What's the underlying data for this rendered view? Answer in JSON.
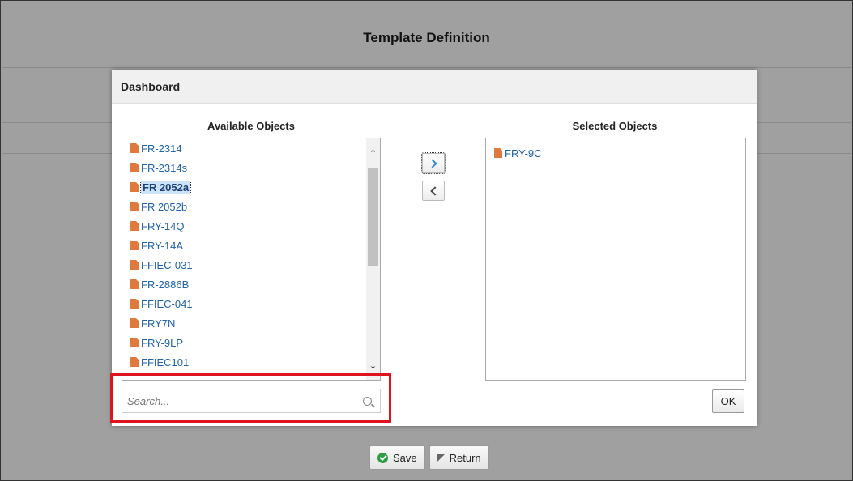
{
  "page": {
    "title": "Template Definition"
  },
  "dialog": {
    "title": "Dashboard",
    "available_title": "Available Objects",
    "selected_title": "Selected Objects",
    "available_items": [
      "FR-2314",
      "FR-2314s",
      "FR 2052a",
      "FR 2052b",
      "FRY-14Q",
      "FRY-14A",
      "FFIEC-031",
      "FR-2886B",
      "FFIEC-041",
      "FRY7N",
      "FRY-9LP",
      "FFIEC101"
    ],
    "selected_available_item": "FR 2052a",
    "selected_items": [
      "FRY-9C"
    ],
    "search": {
      "placeholder": "Search..."
    },
    "ok_label": "OK"
  },
  "footer": {
    "save_label": "Save",
    "return_label": "Return"
  },
  "colors": {
    "link": "#1f62a8",
    "file_icon": "#e07a3c",
    "highlight": "#e0141e",
    "save_icon": "#2f9d45"
  }
}
